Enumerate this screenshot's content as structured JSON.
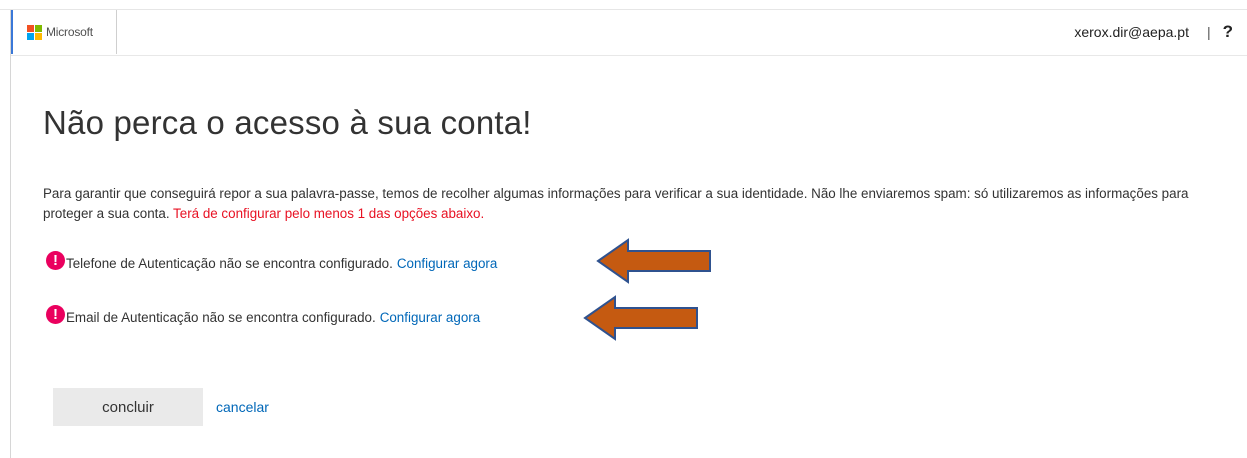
{
  "header": {
    "brand": "Microsoft",
    "user_email": "xerox.dir@aepa.pt",
    "separator": "|",
    "help_label": "?"
  },
  "page": {
    "title": "Não perca o acesso à sua conta!",
    "intro": "Para garantir que conseguirá repor a sua palavra-passe, temos de recolher algumas informações para verificar a sua identidade. Não lhe enviaremos spam: só utilizaremos as informações para proteger a sua conta.",
    "requirement": "Terá de configurar pelo menos 1 das opções abaixo."
  },
  "methods": [
    {
      "status_text": "Telefone de Autenticação não se encontra configurado.",
      "action_label": "Configurar agora",
      "icon": "exclamation-icon"
    },
    {
      "status_text": "Email de Autenticação não se encontra configurado.",
      "action_label": "Configurar agora",
      "icon": "exclamation-icon"
    }
  ],
  "actions": {
    "done_label": "concluir",
    "cancel_label": "cancelar"
  },
  "colors": {
    "link": "#0067b8",
    "warning_text": "#e81123",
    "alert_icon": "#ea005e",
    "annotation_arrow_fill": "#c55a11",
    "annotation_arrow_stroke": "#2f528f"
  }
}
